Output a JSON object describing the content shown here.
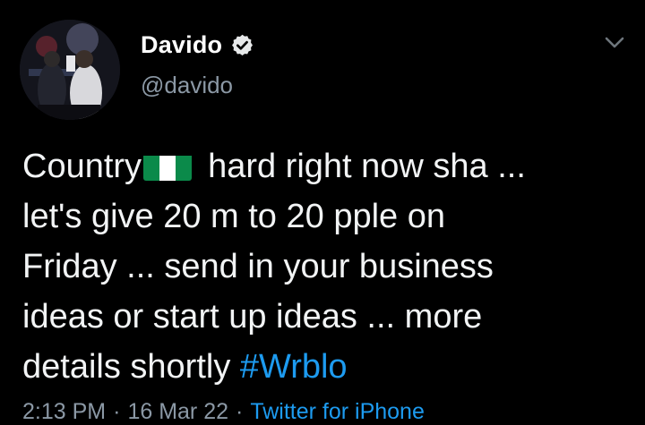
{
  "author": {
    "display_name": "Davido",
    "handle": "@davido",
    "verified": true,
    "avatar_icon": "profile-photo-avatar"
  },
  "tweet": {
    "line1_before_flag": "Country",
    "flag_icon": "nigeria-flag-emoji",
    "line1_after_flag": "hard right now sha ...",
    "line2": "let's give 20 m to 20 pple on",
    "line3": "Friday ... send in your business",
    "line4": "ideas or start up ideas ... more",
    "line5_text": "details shortly ",
    "hashtag": "#Wrblo"
  },
  "meta": {
    "time": "2:13 PM",
    "date": "16 Mar 22",
    "separator": "·",
    "source": "Twitter for iPhone"
  },
  "icons": {
    "verified": "verified-badge-icon",
    "menu": "chevron-down-icon"
  },
  "colors": {
    "background": "#000000",
    "link": "#1d9bf0",
    "secondary_text": "#8b98a5",
    "flag_green": "#0b8a4a"
  }
}
